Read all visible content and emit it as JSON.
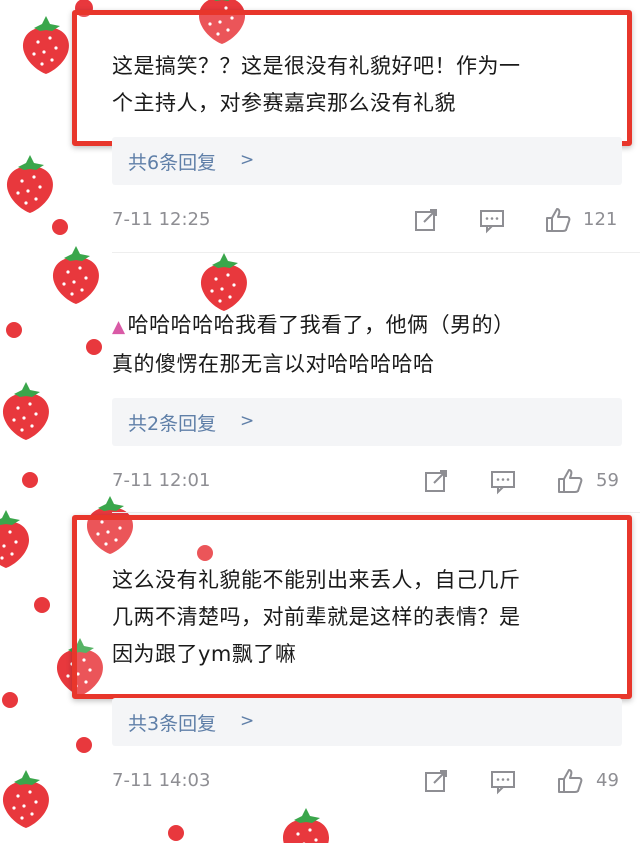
{
  "colors": {
    "accent_red": "#e8362b",
    "link_blue": "#5f7fa8",
    "meta_gray": "#8e8e93",
    "strawberry": "#e8383d",
    "leaf": "#3aa64b"
  },
  "comments": [
    {
      "text_line1": "这是搞笑？？这是很没有礼貌好吧！作为一",
      "text_line2": "个主持人，对参赛嘉宾那么没有礼貌",
      "replies_label": "共6条回复",
      "time": "7-11 12:25",
      "likes": "121",
      "highlighted": true
    },
    {
      "badge_icon": "pink-triangle-icon",
      "text_line1": "哈哈哈哈哈我看了我看了，他俩（男的）",
      "text_line2": "真的傻愣在那无言以对哈哈哈哈哈",
      "replies_label": "共2条回复",
      "time": "7-11 12:01",
      "likes": "59",
      "highlighted": false
    },
    {
      "text_line1": "这么没有礼貌能不能别出来丢人，自己几斤",
      "text_line2": "几两不清楚吗，对前辈就是这样的表情？是",
      "text_line3": "因为跟了ym飘了嘛",
      "replies_label": "共3条回复",
      "time": "7-11 14:03",
      "likes": "49",
      "highlighted": true
    }
  ],
  "icons": {
    "share": "share-edit-icon",
    "comment": "comment-bubble-icon",
    "like": "thumbs-up-icon",
    "chevron": "chevron-right-icon"
  },
  "chevron_glyph": ">"
}
